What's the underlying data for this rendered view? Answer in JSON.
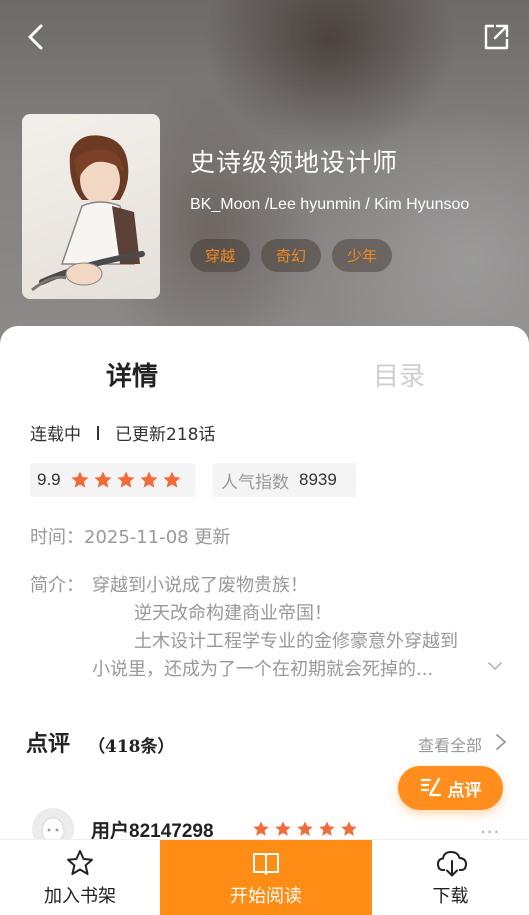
{
  "book": {
    "title": "史诗级领地设计师",
    "authors": "BK_Moon /Lee hyunmin / Kim Hyunsoo",
    "tags": [
      "穿越",
      "奇幻",
      "少年"
    ]
  },
  "tabs": {
    "detail": "详情",
    "toc": "目录"
  },
  "status": {
    "state": "连载中",
    "separator": "I",
    "updated": "已更新218话"
  },
  "rating": {
    "score": "9.9",
    "stars": 5
  },
  "popularity": {
    "label": "人气指数",
    "value": "8939"
  },
  "time": "时间：2025-11-08 更新",
  "intro": {
    "label": "简介：",
    "lines": [
      "穿越到小说成了废物贵族！",
      "逆天改命构建商业帝国！",
      "土木设计工程学专业的金修豪意外穿越到",
      "小说里，还成为了一个在初期就会死掉的..."
    ]
  },
  "reviews": {
    "title": "点评",
    "count": "（418条）",
    "see_all": "查看全部",
    "button_label": "点评",
    "first": {
      "user": "用户82147298",
      "stars": 5,
      "more": "···"
    }
  },
  "bottom_bar": {
    "shelf": "加入书架",
    "read": "开始阅读",
    "download": "下载"
  },
  "colors": {
    "accent": "#ff8c14",
    "star": "#f26b3a",
    "tag_text": "#f08a1f"
  }
}
